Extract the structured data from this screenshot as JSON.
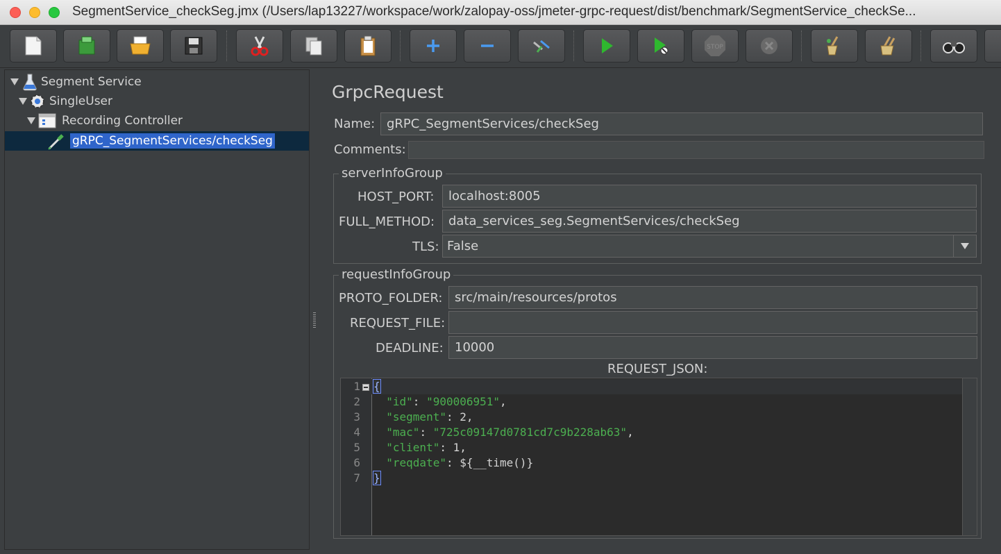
{
  "window": {
    "title": "SegmentService_checkSeg.jmx (/Users/lap13227/workspace/work/zalopay-oss/jmeter-grpc-request/dist/benchmark/SegmentService_checkSe..."
  },
  "toolbar": {
    "buttons": [
      "new-icon",
      "templates-icon",
      "open-icon",
      "save-icon",
      "cut-icon",
      "copy-icon",
      "paste-icon",
      "expand-icon",
      "collapse-icon",
      "toggle-icon",
      "start-icon",
      "start-no-pause-icon",
      "stop-icon",
      "shutdown-icon",
      "clear-icon",
      "clear-all-icon",
      "search-icon",
      "reset-search-icon"
    ]
  },
  "tree": {
    "items": [
      {
        "label": "Segment Service",
        "icon": "test-plan-flask-icon"
      },
      {
        "label": "SingleUser",
        "icon": "thread-group-gear-icon"
      },
      {
        "label": "Recording Controller",
        "icon": "recording-controller-icon"
      },
      {
        "label": "gRPC_SegmentServices/checkSeg",
        "icon": "sampler-pipette-icon",
        "selected": true
      }
    ]
  },
  "panel": {
    "title": "GrpcRequest",
    "name_label": "Name:",
    "name_value": "gRPC_SegmentServices/checkSeg",
    "comments_label": "Comments:",
    "comments_value": "",
    "server_group": {
      "title": "serverInfoGroup",
      "host_port_label": "HOST_PORT:",
      "host_port_value": "localhost:8005",
      "full_method_label": "FULL_METHOD:",
      "full_method_value": "data_services_seg.SegmentServices/checkSeg",
      "tls_label": "TLS:",
      "tls_value": "False"
    },
    "request_group": {
      "title": "requestInfoGroup",
      "proto_folder_label": "PROTO_FOLDER:",
      "proto_folder_value": "src/main/resources/protos",
      "request_file_label": "REQUEST_FILE:",
      "request_file_value": "",
      "deadline_label": "DEADLINE:",
      "deadline_value": "10000",
      "request_json_label": "REQUEST_JSON:"
    },
    "editor": {
      "line_numbers": [
        "1",
        "2",
        "3",
        "4",
        "5",
        "6",
        "7"
      ],
      "lines": [
        {
          "key": "",
          "value": "{"
        },
        {
          "key": "\"id\"",
          "sep": ": ",
          "value": "\"900006951\"",
          "tail": ","
        },
        {
          "key": "\"segment\"",
          "sep": ": ",
          "value": "2",
          "tail": ","
        },
        {
          "key": "\"mac\"",
          "sep": ": ",
          "value": "\"725c09147d0781cd7c9b228ab63\"",
          "tail": ","
        },
        {
          "key": "\"client\"",
          "sep": ": ",
          "value": "1",
          "tail": ","
        },
        {
          "key": "\"reqdate\"",
          "sep": ": ",
          "value": "${__time()}",
          "tail": ""
        },
        {
          "key": "",
          "value": "}"
        }
      ]
    }
  },
  "colors": {
    "background": "#3c3f41",
    "selection": "#2f65ca",
    "json_key": "#4caf50"
  }
}
